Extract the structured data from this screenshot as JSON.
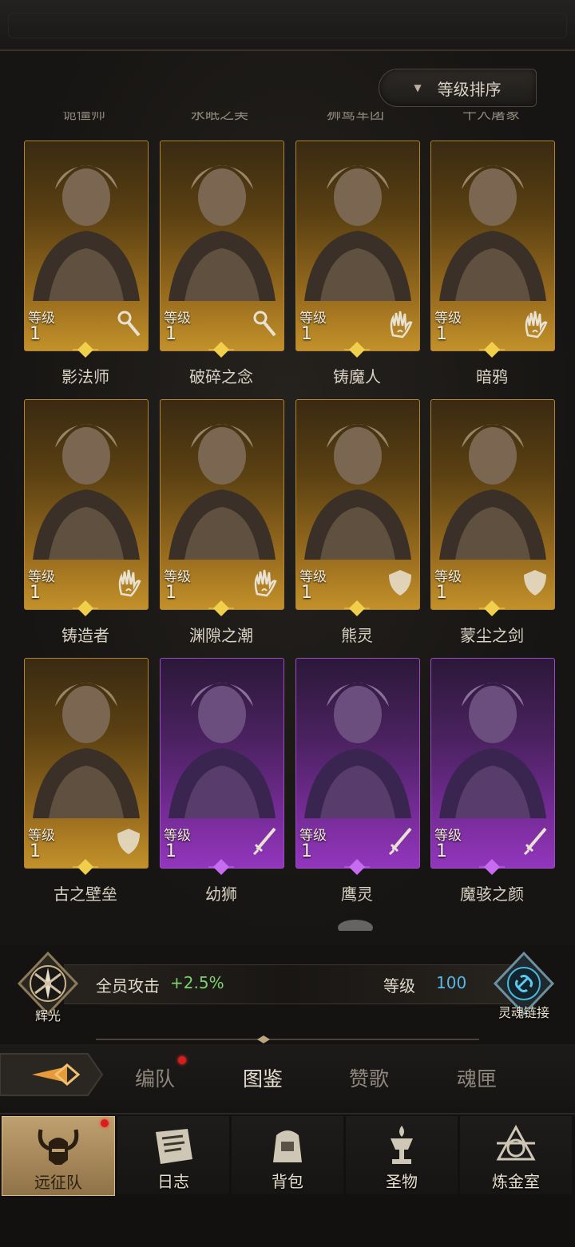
{
  "sort_button": {
    "label": "等级排序",
    "arrow": "▼"
  },
  "partial_names": [
    "诡僵师",
    "永眠之美",
    "狮鹫军团",
    "千人屠象"
  ],
  "level_label": "等级",
  "heroes": [
    {
      "name": "影法师",
      "level": "1",
      "rarity": "gold",
      "class_icon": "staff-icon"
    },
    {
      "name": "破碎之念",
      "level": "1",
      "rarity": "gold",
      "class_icon": "staff-icon"
    },
    {
      "name": "铸魔人",
      "level": "1",
      "rarity": "gold",
      "class_icon": "palm-icon"
    },
    {
      "name": "暗鸦",
      "level": "1",
      "rarity": "gold",
      "class_icon": "palm-icon"
    },
    {
      "name": "铸造者",
      "level": "1",
      "rarity": "gold",
      "class_icon": "palm-icon"
    },
    {
      "name": "渊隙之潮",
      "level": "1",
      "rarity": "gold",
      "class_icon": "palm-icon"
    },
    {
      "name": "熊灵",
      "level": "1",
      "rarity": "gold",
      "class_icon": "shield-icon"
    },
    {
      "name": "蒙尘之剑",
      "level": "1",
      "rarity": "gold",
      "class_icon": "shield-icon"
    },
    {
      "name": "古之壁垒",
      "level": "1",
      "rarity": "gold",
      "class_icon": "shield-icon"
    },
    {
      "name": "幼狮",
      "level": "1",
      "rarity": "purple",
      "class_icon": "sword-icon"
    },
    {
      "name": "鹰灵",
      "level": "1",
      "rarity": "purple",
      "class_icon": "sword-icon"
    },
    {
      "name": "魔骇之颜",
      "level": "1",
      "rarity": "purple",
      "class_icon": "sword-icon"
    }
  ],
  "stats": {
    "radiance_label": "辉光",
    "attack_label": "全员攻击",
    "attack_value": "+2.5%",
    "level_label": "等级",
    "level_value": "100",
    "soul_link_label": "灵魂链接"
  },
  "tabs": [
    {
      "label": "编队",
      "active": false,
      "badge": true
    },
    {
      "label": "图鉴",
      "active": true,
      "badge": false
    },
    {
      "label": "赞歌",
      "active": false,
      "badge": false
    },
    {
      "label": "魂匣",
      "active": false,
      "badge": false
    }
  ],
  "bottom_nav": [
    {
      "label": "远征队",
      "icon": "horned-helmet-icon",
      "active": true,
      "badge": true
    },
    {
      "label": "日志",
      "icon": "scroll-icon",
      "active": false,
      "badge": false
    },
    {
      "label": "背包",
      "icon": "bag-icon",
      "active": false,
      "badge": false
    },
    {
      "label": "圣物",
      "icon": "chalice-icon",
      "active": false,
      "badge": false
    },
    {
      "label": "炼金室",
      "icon": "alchemy-icon",
      "active": false,
      "badge": false
    }
  ],
  "colors": {
    "gold_card": "#c3912a",
    "purple_card": "#9236bd",
    "attack_bonus": "#7cd36c",
    "level_value": "#57b8e6",
    "badge": "#d91d1d"
  }
}
